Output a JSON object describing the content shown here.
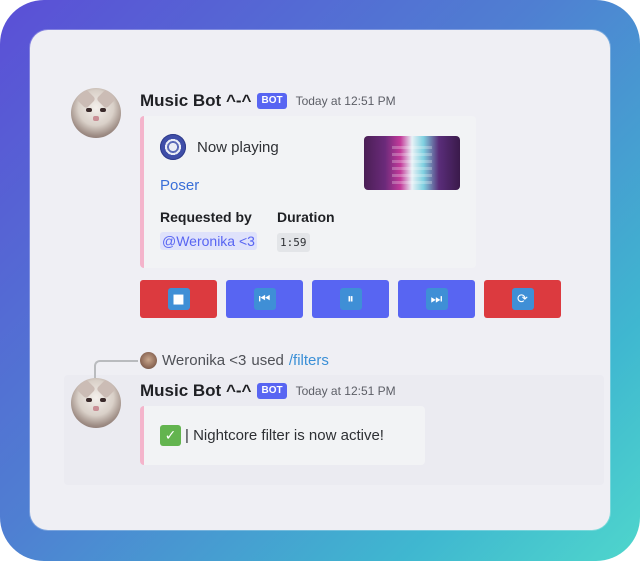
{
  "message1": {
    "author": "Music Bot ^-^",
    "tag": "BOT",
    "timestamp": "Today at 12:51 PM",
    "embed": {
      "icon": "pokeball-icon",
      "title": "Now playing",
      "song": "Poser",
      "fields": [
        {
          "label": "Requested by",
          "value": "@Weronika <3"
        },
        {
          "label": "Duration",
          "value": "1:59"
        }
      ],
      "thumbnail": "album-art"
    },
    "controls": [
      {
        "name": "stop-button",
        "icon": "stop-icon",
        "glyph": "■",
        "color": "#dc3a3f"
      },
      {
        "name": "previous-button",
        "icon": "previous-icon",
        "glyph": "⏮",
        "color": "#5865f2"
      },
      {
        "name": "pause-button",
        "icon": "pause-icon",
        "glyph": "⏸",
        "color": "#5865f2"
      },
      {
        "name": "next-button",
        "icon": "next-icon",
        "glyph": "⏭",
        "color": "#5865f2"
      },
      {
        "name": "loop-button",
        "icon": "loop-icon",
        "glyph": "⟳",
        "color": "#dc3a3f"
      }
    ]
  },
  "reply": {
    "user": "Weronika <3",
    "verb": "used",
    "command": "/filters"
  },
  "message2": {
    "author": "Music Bot ^-^",
    "tag": "BOT",
    "timestamp": "Today at 12:51 PM",
    "embed": {
      "check": "✓",
      "text": "| Nightcore filter is now active!"
    }
  },
  "colors": {
    "accent": "#5865f2",
    "danger": "#dc3a3f",
    "embed_border": "#f4b4cb",
    "link": "#3a6fd8"
  }
}
